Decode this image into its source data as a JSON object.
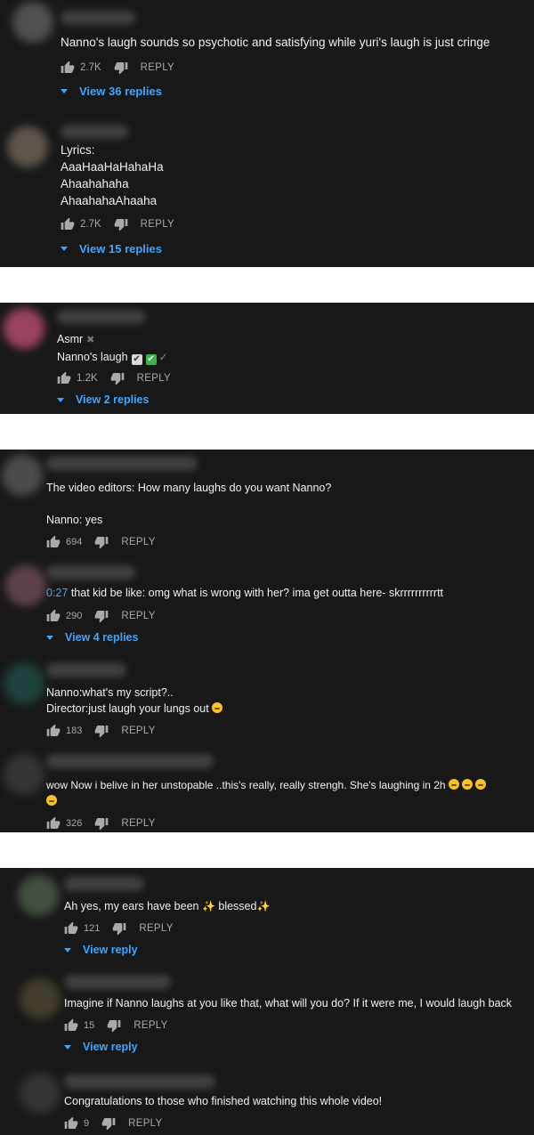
{
  "actions": {
    "reply_label": "REPLY"
  },
  "panel1": {
    "comments": [
      {
        "text_lines": [
          "Nanno's laugh sounds so psychotic and satisfying while yuri's laugh is just cringe"
        ],
        "likes": "2.7K",
        "view_replies": "View 36 replies"
      },
      {
        "text_lines": [
          "Lyrics:",
          "AaaHaaHaHahaHa",
          "Ahaahahaha",
          "AhaahahaAhaaha"
        ],
        "likes": "2.7K",
        "view_replies": "View 15 replies"
      }
    ]
  },
  "panel2": {
    "comments": [
      {
        "line1": "Asmr",
        "line2": "Nanno's laugh",
        "likes": "1.2K",
        "view_replies": "View 2 replies"
      }
    ]
  },
  "panel3": {
    "comments": [
      {
        "text_lines": [
          "The video editors: How many laughs do you want Nanno?",
          "",
          "Nanno: yes"
        ],
        "likes": "694"
      },
      {
        "timestamp": "0:27",
        "text": " that kid be like: omg what is wrong with her? ima get outta here- skrrrrrrrrrrtt",
        "likes": "290",
        "view_replies": "View 4 replies"
      },
      {
        "text_lines": [
          "Nanno:what's my script?..",
          "Director:just laugh your lungs out"
        ],
        "likes": "183"
      },
      {
        "text": "wow Now i belive in her unstopable ..this's really, really strengh. She's laughing in 2h",
        "likes": "326"
      }
    ]
  },
  "panel4": {
    "comments": [
      {
        "text_a": "Ah yes, my ears have been ",
        "text_b": " blessed",
        "likes": "121",
        "view_replies": "View reply"
      },
      {
        "text": "Imagine if Nanno laughs at you like that, what will you do? If it were me, I would laugh back",
        "likes": "15",
        "view_replies": "View reply"
      },
      {
        "text": "Congratulations to those who finished watching this whole video!",
        "likes": "9"
      }
    ]
  },
  "colors": {
    "panel_bg": "#181818",
    "text": "#f1f1f1",
    "secondary": "#aaaaaa",
    "link": "#3ea6ff"
  }
}
